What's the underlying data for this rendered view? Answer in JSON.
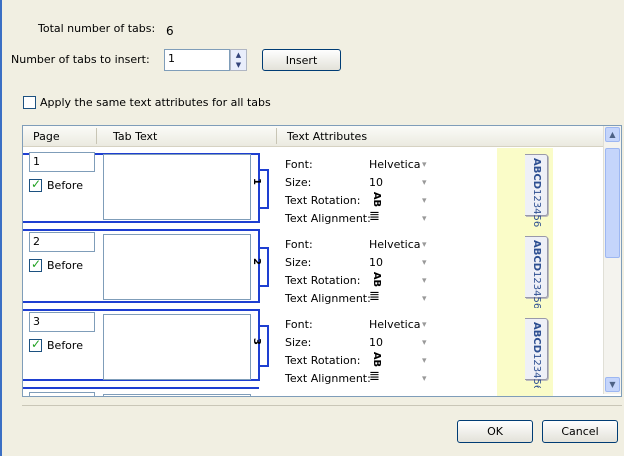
{
  "header": {
    "total_label": "Total number of tabs:",
    "total_value": "6",
    "insert_label": "Number of tabs to insert:",
    "insert_value": "1",
    "insert_button": "Insert",
    "same_attr_label": "Apply the same text attributes for all tabs",
    "same_attr_checked": false
  },
  "table": {
    "columns": [
      "Page",
      "Tab Text",
      "Text Attributes"
    ],
    "attr_labels": [
      "Font:",
      "Size:",
      "Text Rotation:",
      "Text Alignment:"
    ],
    "rows": [
      {
        "page": "1",
        "before": "Before",
        "checked": true,
        "tab_number": "1",
        "font": "Helvetica",
        "size": "10",
        "rotation_glyph": "AB",
        "preview_line1": "ABCD",
        "preview_line2": "123456"
      },
      {
        "page": "2",
        "before": "Before",
        "checked": true,
        "tab_number": "2",
        "font": "Helvetica",
        "size": "10",
        "rotation_glyph": "AB",
        "preview_line1": "ABCD",
        "preview_line2": "123456"
      },
      {
        "page": "3",
        "before": "Before",
        "checked": true,
        "tab_number": "3",
        "font": "Helvetica",
        "size": "10",
        "rotation_glyph": "AB",
        "preview_line1": "ABCD",
        "preview_line2": "123456"
      }
    ]
  },
  "footer": {
    "ok_label": "OK",
    "cancel_label": "Cancel"
  },
  "colors": {
    "tab_outline": "#1e3fd1",
    "preview_bg": "#fafcc8",
    "dialog_bg": "#f1efe2"
  },
  "icons": {
    "spinner": "up-down-spinner-icon",
    "scroll_up": "scroll-up-arrow-icon",
    "scroll_down": "scroll-down-arrow-icon",
    "alignment": "align-left-icon",
    "dropdown": "chevron-down-icon"
  }
}
